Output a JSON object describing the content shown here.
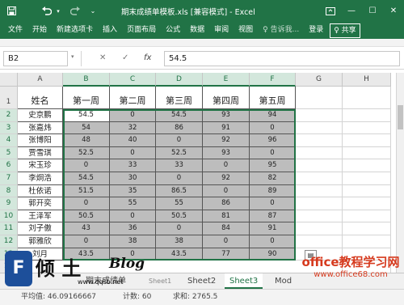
{
  "window": {
    "title": "期末成绩单模板.xls [兼容模式] - Excel",
    "save_icon": "save-icon",
    "undo_icon": "undo-icon",
    "redo_icon": "redo-icon",
    "restore_icon": "ribbon-display-icon",
    "minimize_glyph": "—",
    "maximize_glyph": "☐",
    "close_glyph": "✕"
  },
  "ribbon": {
    "tabs": [
      "文件",
      "开始",
      "新建选项卡",
      "插入",
      "页面布局",
      "公式",
      "数据",
      "审阅",
      "视图"
    ],
    "tell_me": "♀ 告诉我...",
    "login": "登录",
    "share": "♀ 共享"
  },
  "formula_bar": {
    "name_box": "B2",
    "cancel": "✕",
    "enter": "✓",
    "fx": "fx",
    "value": "54.5"
  },
  "columns": [
    "A",
    "B",
    "C",
    "D",
    "E",
    "F",
    "G",
    "H"
  ],
  "rows": [
    "1",
    "2",
    "3",
    "4",
    "5",
    "6",
    "7",
    "8",
    "9",
    "10",
    "11",
    "12",
    "13",
    "14"
  ],
  "table": {
    "headers": [
      "姓名",
      "第一周",
      "第二周",
      "第三周",
      "第四周",
      "第五周"
    ],
    "rows": [
      [
        "史京鹏",
        "54.5",
        "0",
        "54.5",
        "93",
        "94"
      ],
      [
        "张嘉炜",
        "54",
        "32",
        "86",
        "91",
        "0"
      ],
      [
        "张博阳",
        "48",
        "40",
        "0",
        "92",
        "96"
      ],
      [
        "贾雪琪",
        "52.5",
        "0",
        "52.5",
        "93",
        "0"
      ],
      [
        "宋玉珍",
        "0",
        "33",
        "33",
        "0",
        "95"
      ],
      [
        "李炯浩",
        "54.5",
        "30",
        "0",
        "92",
        "82"
      ],
      [
        "杜依诺",
        "51.5",
        "35",
        "86.5",
        "0",
        "89"
      ],
      [
        "郭开奕",
        "0",
        "55",
        "55",
        "86",
        "0"
      ],
      [
        "王泽军",
        "50.5",
        "0",
        "50.5",
        "81",
        "87"
      ],
      [
        "刘子傲",
        "43",
        "36",
        "0",
        "84",
        "91"
      ],
      [
        "郭雅欣",
        "0",
        "38",
        "38",
        "0",
        "0"
      ],
      [
        "刘月",
        "43.5",
        "0",
        "43.5",
        "77",
        "90"
      ]
    ]
  },
  "sheet_tabs": [
    "期末成绩单",
    "Sheet1",
    "Sheet2",
    "Sheet3",
    "Mod"
  ],
  "status": {
    "average": "平均值: 46.09166667",
    "count": "计数: 60",
    "sum": "求和: 2765.5"
  },
  "watermarks": {
    "logo_char": "F",
    "brand": "倾 土",
    "blog": "Blog",
    "url": "www.qqsb.net",
    "office_main": "office教程学习网",
    "office_url": "www.office68.com"
  },
  "colors": {
    "excel_green": "#217346",
    "selection_fill": "#bdbdbd",
    "watermark_red": "#d63a1e"
  }
}
